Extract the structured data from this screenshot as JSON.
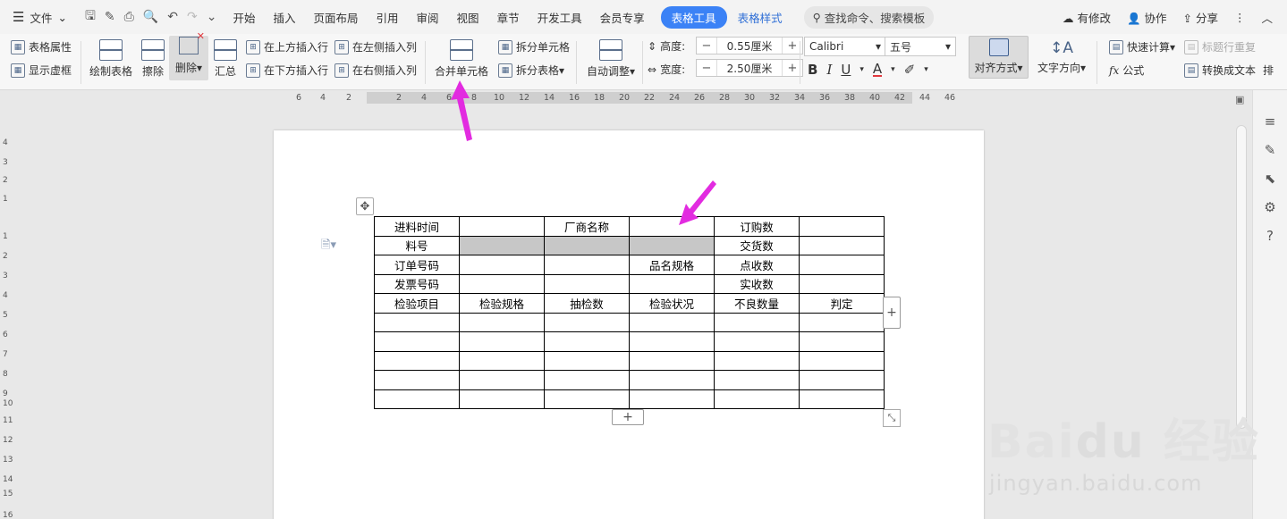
{
  "menubar": {
    "file_label": "文件",
    "tabs": [
      "开始",
      "插入",
      "页面布局",
      "引用",
      "审阅",
      "视图",
      "章节",
      "开发工具",
      "会员专享"
    ],
    "active_tab": "表格工具",
    "style_tab": "表格样式",
    "search_placeholder": "查找命令、搜索模板",
    "right": {
      "modified": "有修改",
      "collab": "协作",
      "share": "分享"
    }
  },
  "ribbon": {
    "table_props": "表格属性",
    "show_grid": "显示虚框",
    "draw_table": "绘制表格",
    "erase": "擦除",
    "delete": "删除",
    "summary": "汇总",
    "insert_above": "在上方插入行",
    "insert_below": "在下方插入行",
    "insert_left": "在左侧插入列",
    "insert_right": "在右侧插入列",
    "merge_cells": "合并单元格",
    "split_cells": "拆分单元格",
    "split_table": "拆分表格",
    "auto_fit": "自动调整",
    "height_label": "高度:",
    "height_value": "0.55厘米",
    "width_label": "宽度:",
    "width_value": "2.50厘米",
    "font_name": "Calibri",
    "font_size": "五号",
    "align": "对齐方式",
    "text_dir": "文字方向",
    "quick_calc": "快速计算",
    "header_repeat": "标题行重复",
    "formula": "公式",
    "convert_text": "转换成文本",
    "sort": "排"
  },
  "ruler": {
    "h_ticks": [
      "6",
      "4",
      "2",
      "2",
      "4",
      "6",
      "8",
      "10",
      "12",
      "14",
      "16",
      "18",
      "20",
      "22",
      "24",
      "26",
      "28",
      "30",
      "32",
      "34",
      "36",
      "38",
      "40",
      "42",
      "44",
      "46"
    ],
    "v_ticks": [
      "4",
      "3",
      "2",
      "1",
      "1",
      "2",
      "3",
      "4",
      "5",
      "6",
      "7",
      "8",
      "9",
      "10",
      "11",
      "12",
      "13",
      "14",
      "15",
      "16"
    ]
  },
  "table": {
    "rows": [
      [
        "进料时间",
        "",
        "厂商名称",
        "",
        "订购数",
        ""
      ],
      [
        "料号",
        "",
        "",
        "",
        "交货数",
        ""
      ],
      [
        "订单号码",
        "",
        "",
        "品名规格",
        "点收数",
        ""
      ],
      [
        "发票号码",
        "",
        "",
        "",
        "实收数",
        ""
      ],
      [
        "检验项目",
        "检验规格",
        "抽检数",
        "检验状况",
        "不良数量",
        "判定"
      ],
      [
        "",
        "",
        "",
        "",
        "",
        ""
      ],
      [
        "",
        "",
        "",
        "",
        "",
        ""
      ],
      [
        "",
        "",
        "",
        "",
        "",
        ""
      ],
      [
        "",
        "",
        "",
        "",
        "",
        ""
      ],
      [
        "",
        "",
        "",
        "",
        "",
        ""
      ]
    ],
    "selected": [
      [
        1,
        1
      ],
      [
        1,
        2
      ],
      [
        1,
        3
      ]
    ]
  },
  "colors": {
    "accent": "#3b82f6",
    "annotation": "#e22be0"
  },
  "watermark": {
    "brand": "Bai du 经验",
    "url": "jingyan.baidu.com"
  }
}
